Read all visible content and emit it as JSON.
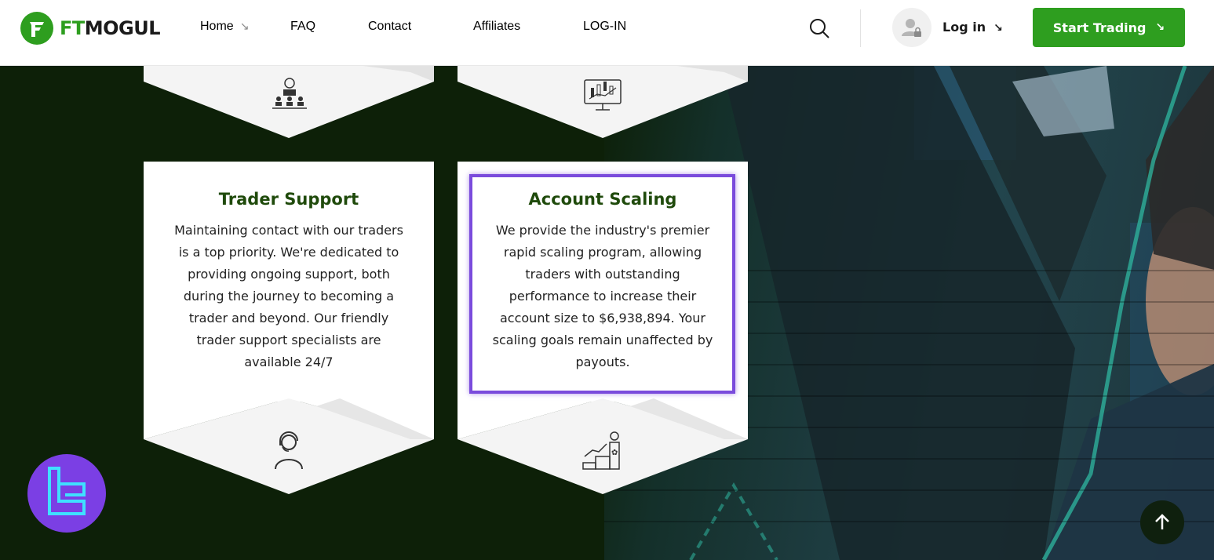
{
  "header": {
    "logo_ft": "FT",
    "logo_mogul": "MOGUL",
    "nav": [
      {
        "label": "Home",
        "arrow": "↘"
      },
      {
        "label": "FAQ"
      },
      {
        "label": "Contact"
      },
      {
        "label": "Affiliates"
      },
      {
        "label": "LOG-IN"
      }
    ],
    "login_label": "Log in",
    "login_arrow": "↘",
    "cta_label": "Start Trading",
    "cta_arrow": "↘"
  },
  "cards": [
    {
      "title": "Trader Support",
      "body": [
        "Maintaining contact with our traders",
        "is a top priority. We're dedicated to",
        "providing ongoing support, both",
        "during the journey to becoming a",
        "trader and beyond. Our friendly",
        "trader support specialists are",
        "available 24/7"
      ],
      "icon": "headset-user-icon"
    },
    {
      "title": "Account Scaling",
      "body": [
        "We provide the industry's premier",
        "rapid scaling program, allowing",
        "traders with outstanding",
        "performance to increase their",
        "account size to $6,938,894. Your",
        "scaling goals remain unaffected by",
        "payouts."
      ],
      "icon": "growth-podium-icon"
    }
  ],
  "top_icons": [
    "audience-presenter-icon",
    "trading-monitor-icon"
  ],
  "colors": {
    "brand_green": "#2e9e1f",
    "title_green": "#1f4a0b",
    "highlight": "#7a4bdc",
    "bg_dark": "#0d2008"
  }
}
